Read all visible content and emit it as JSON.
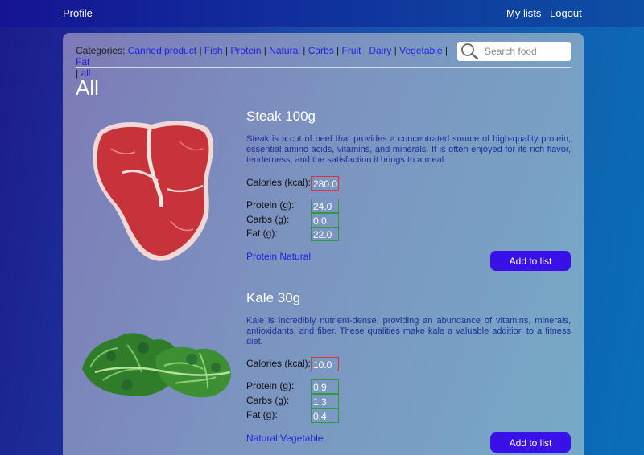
{
  "nav": {
    "profile": "Profile",
    "my_lists": "My lists",
    "logout": "Logout"
  },
  "categories": {
    "label": "Categories:",
    "items": [
      "Canned product",
      "Fish",
      "Protein",
      "Natural",
      "Carbs",
      "Fruit",
      "Dairy",
      "Vegetable",
      "Fat",
      "all"
    ]
  },
  "search": {
    "placeholder": "Search food",
    "value": ""
  },
  "heading": "All",
  "foods": [
    {
      "title": "Steak 100g",
      "description": "Steak is a cut of beef that provides a concentrated source of high-quality protein, essential amino acids, vitamins, and minerals. It is often enjoyed for its rich flavor, tenderness, and the satisfaction it brings to a meal.",
      "calories_label": "Calories (kcal):",
      "calories": "280.0",
      "protein_label": "Protein (g):",
      "protein": "24.0",
      "carbs_label": "Carbs (g):",
      "carbs": "0.0",
      "fat_label": "Fat (g):",
      "fat": "22.0",
      "tags": "Protein Natural",
      "button": "Add to list",
      "image": "steak-image"
    },
    {
      "title": "Kale 30g",
      "description": "Kale is incredibly nutrient-dense, providing an abundance of vitamins, minerals, antioxidants, and fiber. These qualities make kale a valuable addition to a fitness diet.",
      "calories_label": "Calories (kcal):",
      "calories": "10.0",
      "protein_label": "Protein (g):",
      "protein": "0.9",
      "carbs_label": "Carbs (g):",
      "carbs": "1.3",
      "fat_label": "Fat (g):",
      "fat": "0.4",
      "tags": "Natural Vegetable",
      "button": "Add to list",
      "image": "kale-image"
    }
  ],
  "colors": {
    "accent_button": "#3a10e8",
    "link": "#2222dd",
    "calorie_border": "#d63a3a",
    "macro_border": "#2e9b3a",
    "description_text": "#1c2f9a"
  }
}
